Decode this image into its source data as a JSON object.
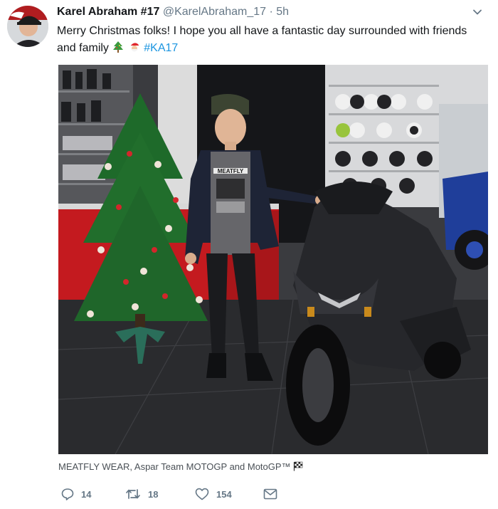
{
  "tweet": {
    "author_name": "Karel Abraham #17",
    "handle": "@KarelAbraham_17",
    "separator": "·",
    "time": "5h",
    "text_main": "Merry Christmas folks! I hope you all have a fantastic day surrounded with friends and family",
    "emojis": [
      "christmas-tree-emoji",
      "santa-emoji"
    ],
    "hashtag": "#KA17",
    "media_caption": "MEATFLY WEAR, Aspar Team MOTOGP and MotoGP™",
    "caption_icon": "checkered-flag-icon",
    "shirt_print": "MEATFLY"
  },
  "actions": {
    "reply_count": "14",
    "retweet_count": "18",
    "like_count": "154"
  },
  "colors": {
    "link": "#1b95e0",
    "secondary_text": "#657786",
    "primary_text": "#14171a"
  }
}
